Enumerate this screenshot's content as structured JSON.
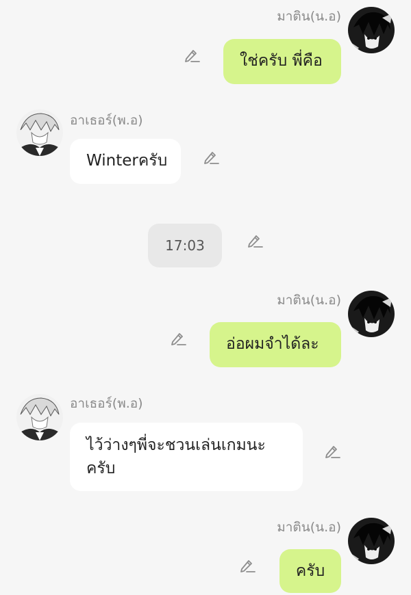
{
  "messages": [
    {
      "sender": "มาติน(น.อ)",
      "side": "sent",
      "text": "ใช่ครับ พี่คือ"
    },
    {
      "sender": "อาเธอร์(พ.อ)",
      "side": "received",
      "text": "Winterครับ"
    },
    {
      "side": "timestamp",
      "text": "17:03"
    },
    {
      "sender": "มาติน(น.อ)",
      "side": "sent",
      "text": "อ่อผมจำได้ละ"
    },
    {
      "sender": "อาเธอร์(พ.อ)",
      "side": "received",
      "text": "ไว้ว่างๆพี่จะชวนเล่นเกมนะครับ"
    },
    {
      "sender": "มาติน(น.อ)",
      "side": "sent",
      "text": "ครับ"
    }
  ],
  "colors": {
    "sent_bubble": "#d6f48c",
    "received_bubble": "#ffffff",
    "timestamp_bubble": "#e8e8e8",
    "background": "#f6f6f6",
    "name_text": "#8a8a8a"
  },
  "icons": {
    "edit": "pencil-icon",
    "avatar_sent": "avatar-matin",
    "avatar_received": "avatar-arthur"
  }
}
